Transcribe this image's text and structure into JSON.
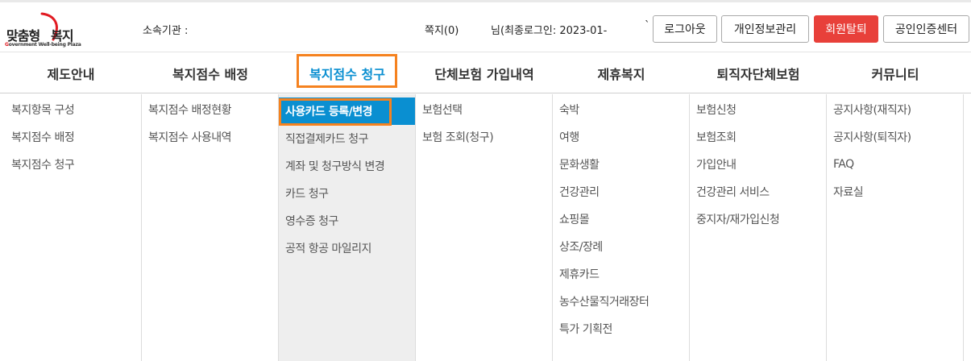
{
  "brand": {
    "main_left": "맞춤형",
    "main_right": "복지",
    "sub_g": "G",
    "sub_rest": "overnment Well-being Plaza"
  },
  "header": {
    "org_label": "소속기관 :",
    "note_label": "쪽지(0)",
    "login_info": "님(최종로그인: 2023-01-",
    "tick": "`",
    "buttons": {
      "logout": "로그아웃",
      "profile": "개인정보관리",
      "withdraw": "회원탈퇴",
      "cert": "공인인증센터"
    }
  },
  "colors": {
    "accent_blue": "#0a8fd1",
    "highlight_orange": "#f5821f",
    "withdraw_red": "#e8403a"
  },
  "nav": {
    "items": [
      {
        "label": "제도안내"
      },
      {
        "label": "복지점수 배정"
      },
      {
        "label": "복지점수 청구"
      },
      {
        "label": "단체보험 가입내역"
      },
      {
        "label": "제휴복지"
      },
      {
        "label": "퇴직자단체보험"
      },
      {
        "label": "커뮤니티"
      }
    ],
    "active_index": 2
  },
  "submenus": [
    {
      "items": [
        "복지항목 구성",
        "복지점수 배정",
        "복지점수 청구"
      ]
    },
    {
      "items": [
        "복지점수 배정현황",
        "복지점수 사용내역"
      ]
    },
    {
      "items": [
        "사용카드 등록/변경",
        "직접결제카드 청구",
        "계좌 및 청구방식 변경",
        "카드 청구",
        "영수증 청구",
        "공적 항공 마일리지"
      ]
    },
    {
      "items": [
        "보험선택",
        "보험 조회(청구)"
      ]
    },
    {
      "items": [
        "숙박",
        "여행",
        "문화생활",
        "건강관리",
        "쇼핑몰",
        "상조/장례",
        "제휴카드",
        "농수산물직거래장터",
        "특가 기획전"
      ]
    },
    {
      "items": [
        "보험신청",
        "보험조회",
        "가입안내",
        "건강관리 서비스",
        "중지자/재가입신청"
      ]
    },
    {
      "items": [
        "공지사항(재직자)",
        "공지사항(퇴직자)",
        "FAQ",
        "자료실"
      ]
    }
  ],
  "selected_submenu": "사용카드 등록/변경"
}
